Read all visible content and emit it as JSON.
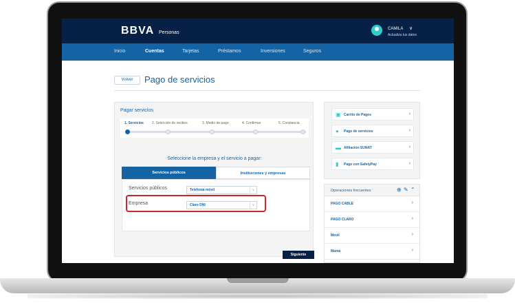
{
  "header": {
    "logo": "BBVA",
    "logo_sub": "Personas",
    "user_name": "CAMILA",
    "user_sub": "Actualiza tus datos"
  },
  "nav": {
    "items": [
      "Inicio",
      "Cuentas",
      "Tarjetas",
      "Préstamos",
      "Inversiones",
      "Seguros"
    ],
    "active": "Cuentas"
  },
  "page": {
    "back_label": "Volver",
    "title": "Pago de servicios"
  },
  "main_panel": {
    "title": "Pagar servicios",
    "steps": [
      "1. Servicios",
      "2. Selección de recibos",
      "3. Medio de pago",
      "4. Confirmar",
      "5. Constancia"
    ],
    "active_step": 1,
    "instruction": "Seleccione la empresa y el servicio a pagar:",
    "tabs": [
      "Servicios públicos",
      "Instituciones y empresas"
    ],
    "fields": [
      {
        "label": "Servicios públicos",
        "value": "Telefonía móvil"
      },
      {
        "label": "Empresa",
        "value": "Claro DNI"
      }
    ],
    "next_label": "Siguiente"
  },
  "side": {
    "links": [
      {
        "label": "Carrito de Pagos",
        "icon": "cart-icon"
      },
      {
        "label": "Pago de servicios",
        "icon": "payment-icon"
      },
      {
        "label": "Afiliación SUNAT",
        "icon": "id-card-icon"
      },
      {
        "label": "Pago con SafetyPay",
        "icon": "chart-icon"
      }
    ],
    "frequent": {
      "title": "Operaciones frecuentes",
      "items": [
        "PAGO CABLE",
        "PAGO CLARO",
        "Movil",
        "Mamá"
      ]
    }
  },
  "colors": {
    "navy": "#072146",
    "blue": "#1464a5",
    "aqua": "#2dcccd",
    "highlight_red": "#c8242b"
  }
}
